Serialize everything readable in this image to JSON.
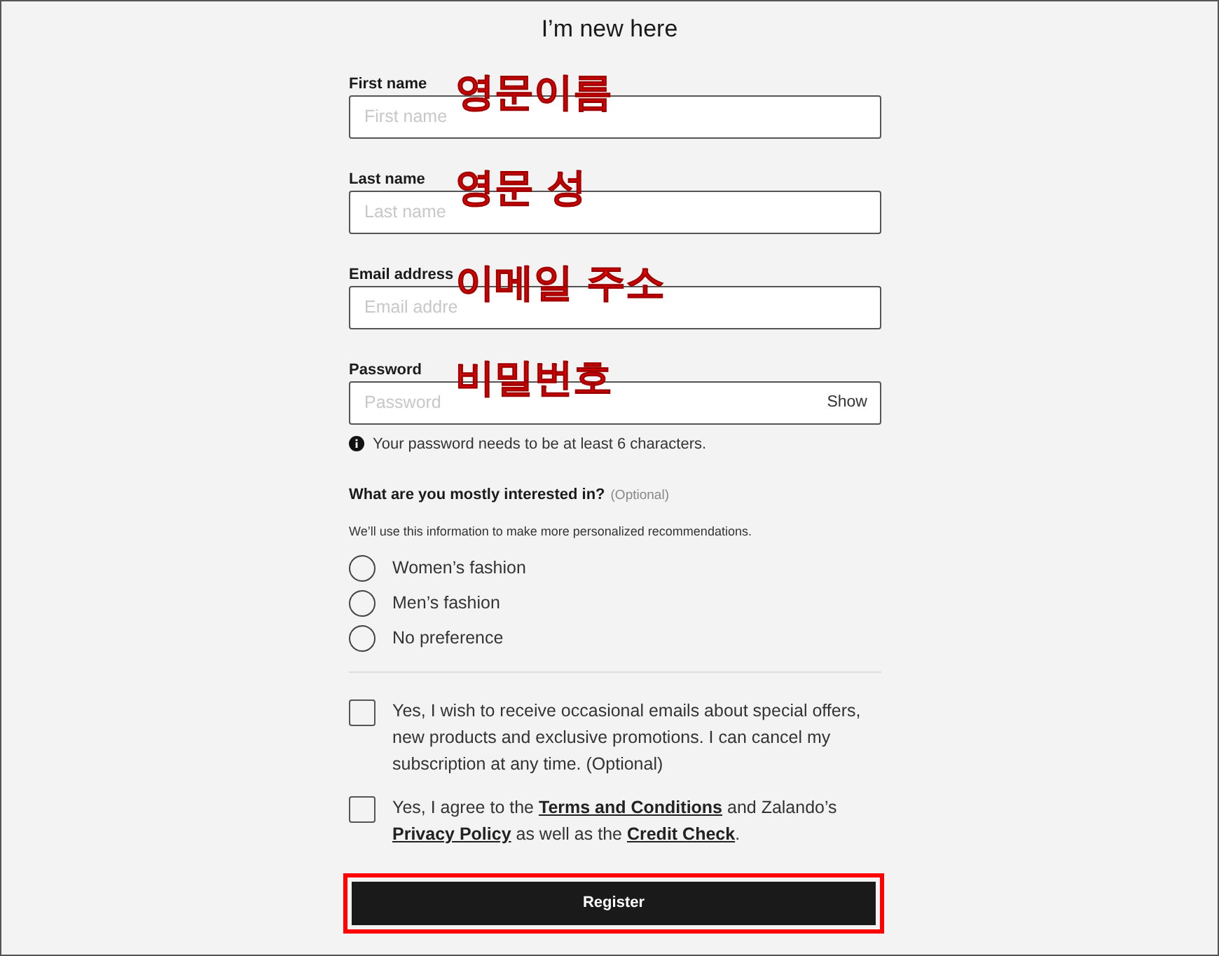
{
  "title": "I’m new here",
  "fields": [
    {
      "label": "First name",
      "placeholder": "First name",
      "annotation": "영문이름"
    },
    {
      "label": "Last name",
      "placeholder": "Last name",
      "annotation": "영문 성"
    },
    {
      "label": "Email address",
      "placeholder": "Email addre",
      "annotation": "이메일 주소"
    },
    {
      "label": "Password",
      "placeholder": "Password",
      "annotation": "비밀번호",
      "action": "Show"
    }
  ],
  "password_hint": "Your password needs to be at least 6 characters.",
  "interest": {
    "question": "What are you mostly interested in?",
    "optional": "(Optional)",
    "note": "We’ll use this information to make more personalized recommendations.",
    "options": [
      {
        "label": "Women’s fashion",
        "selected": false
      },
      {
        "label": "Men’s fashion",
        "selected": false
      },
      {
        "label": "No preference",
        "selected": false
      }
    ]
  },
  "consents": [
    {
      "checked": false,
      "parts": [
        {
          "kind": "text",
          "text": "Yes, I wish to receive occasional emails about special offers, new products and exclusive promotions. I can cancel my subscription at any time. (Optional)"
        }
      ]
    },
    {
      "checked": false,
      "parts": [
        {
          "kind": "text",
          "text": "Yes, I agree to the "
        },
        {
          "kind": "link",
          "text": "Terms and Conditions"
        },
        {
          "kind": "text",
          "text": " and Zalando’s "
        },
        {
          "kind": "link",
          "text": "Privacy Policy"
        },
        {
          "kind": "text",
          "text": " as well as the "
        },
        {
          "kind": "link",
          "text": "Credit Check"
        },
        {
          "kind": "text",
          "text": "."
        }
      ]
    }
  ],
  "register": {
    "label": "Register",
    "highlighted": true
  }
}
